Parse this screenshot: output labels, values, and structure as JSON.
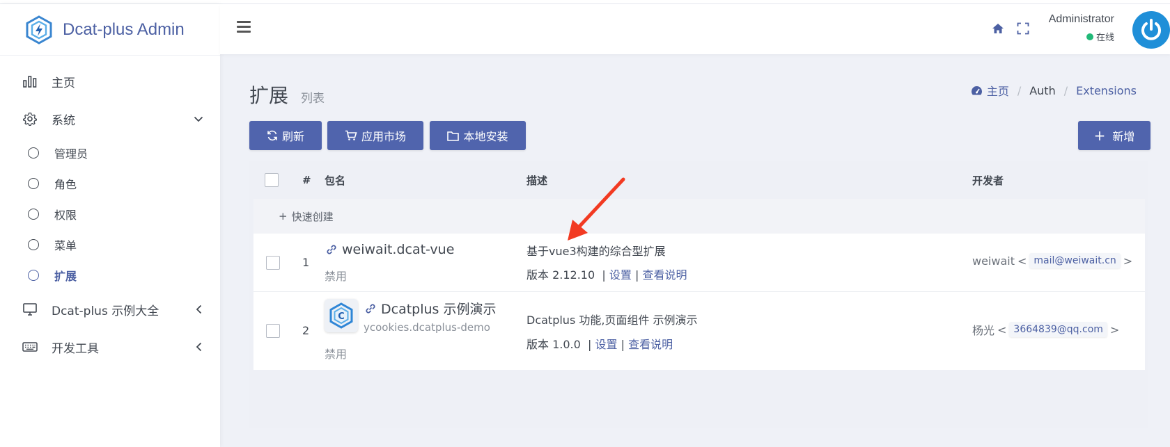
{
  "brand": {
    "name": "Dcat-plus Admin"
  },
  "sidebar": {
    "items": [
      {
        "label": "主页"
      },
      {
        "label": "系统"
      },
      {
        "label": "Dcat-plus 示例大全"
      },
      {
        "label": "开发工具"
      }
    ],
    "sub_items": [
      {
        "label": "管理员"
      },
      {
        "label": "角色"
      },
      {
        "label": "权限"
      },
      {
        "label": "菜单"
      },
      {
        "label": "扩展"
      }
    ]
  },
  "header": {
    "user_name": "Administrator",
    "status": "在线"
  },
  "page": {
    "title": "扩展",
    "subtitle": "列表"
  },
  "breadcrumb": {
    "home": "主页",
    "auth": "Auth",
    "current": "Extensions"
  },
  "toolbar": {
    "refresh": "刷新",
    "market": "应用市场",
    "local_install": "本地安装",
    "add_new": "新增"
  },
  "table": {
    "headers": {
      "index": "#",
      "package": "包名",
      "description": "描述",
      "developer": "开发者"
    },
    "quick_create": "快速创建",
    "rows": [
      {
        "index": "1",
        "name": "weiwait.dcat-vue",
        "status": "禁用",
        "description": "基于vue3构建的综合型扩展",
        "version": "版本 2.12.10",
        "settings": "设置",
        "readme": "查看说明",
        "developer": "weiwait",
        "email": "mail@weiwait.cn"
      },
      {
        "index": "2",
        "name": "Dcatplus 示例演示",
        "package": "ycookies.dcatplus-demo",
        "status": "禁用",
        "description": "Dcatplus 功能,页面组件 示例演示",
        "version": "版本 1.0.0",
        "settings": "设置",
        "readme": "查看说明",
        "developer": "杨光",
        "email": "3664839@qq.com"
      }
    ]
  },
  "colors": {
    "primary": "#5064ad",
    "accent_text": "#4c60a3",
    "online": "#21b978",
    "arrow": "#f23a22"
  }
}
